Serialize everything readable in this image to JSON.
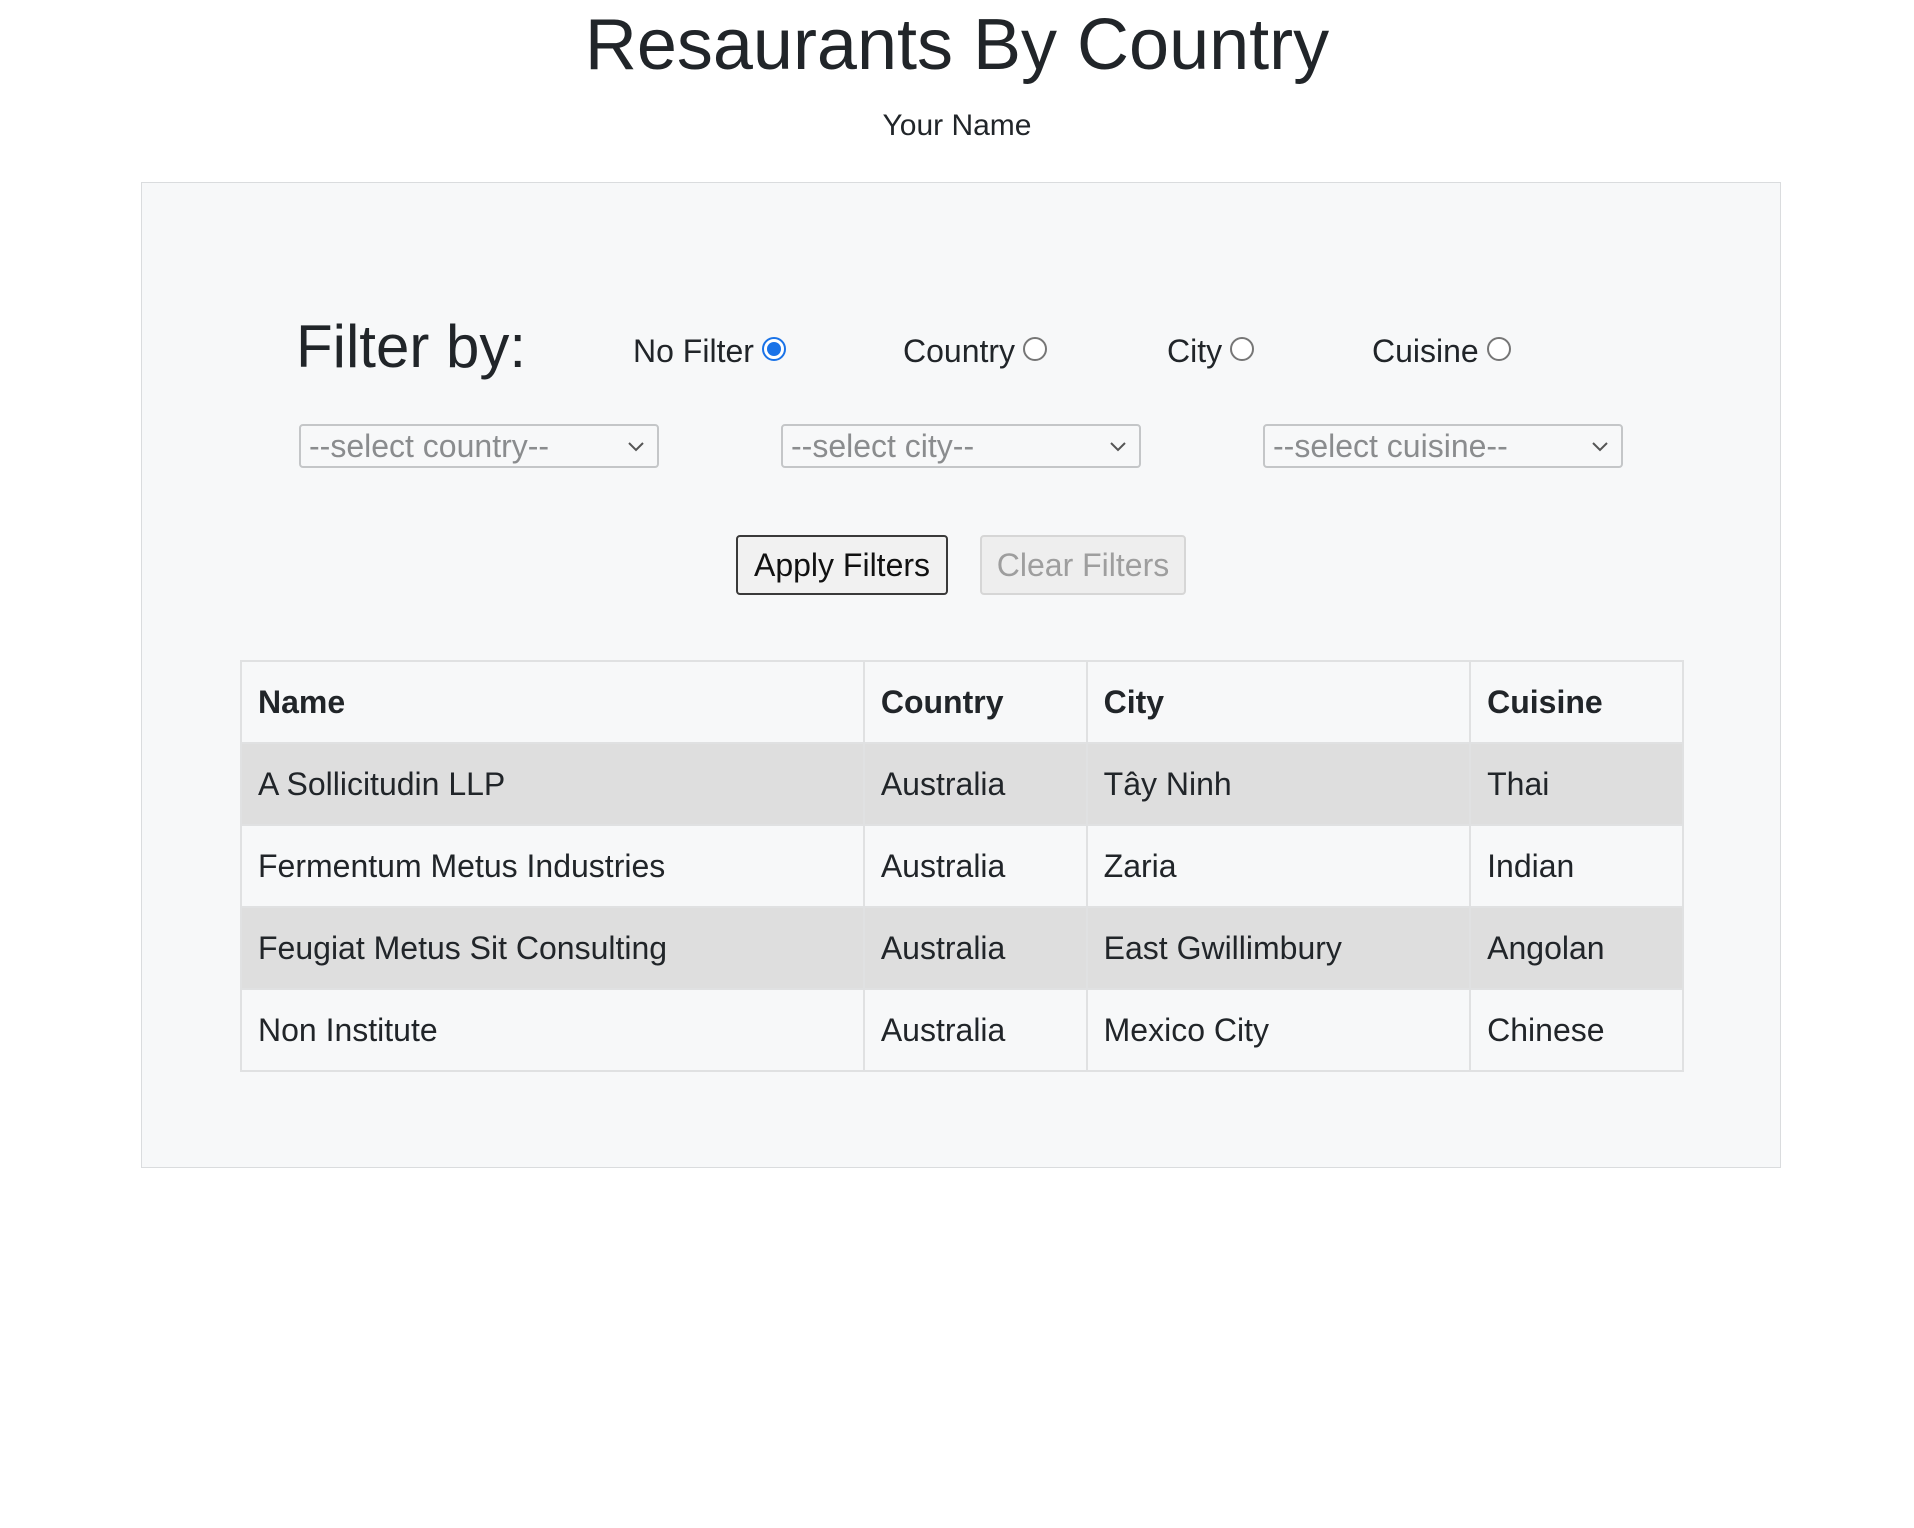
{
  "header": {
    "title": "Resaurants By Country",
    "subtitle": "Your Name"
  },
  "filters": {
    "heading": "Filter by:",
    "options": [
      {
        "label": "No Filter",
        "checked": true
      },
      {
        "label": "Country",
        "checked": false
      },
      {
        "label": "City",
        "checked": false
      },
      {
        "label": "Cuisine",
        "checked": false
      }
    ],
    "selects": {
      "country_placeholder": "--select country--",
      "city_placeholder": "--select city--",
      "cuisine_placeholder": "--select cuisine--"
    },
    "apply_label": "Apply Filters",
    "clear_label": "Clear Filters"
  },
  "table": {
    "headers": [
      "Name",
      "Country",
      "City",
      "Cuisine"
    ],
    "rows": [
      [
        "A Sollicitudin LLP",
        "Australia",
        "Tây Ninh",
        "Thai"
      ],
      [
        "Fermentum Metus Industries",
        "Australia",
        "Zaria",
        "Indian"
      ],
      [
        "Feugiat Metus Sit Consulting",
        "Australia",
        "East Gwillimbury",
        "Angolan"
      ],
      [
        "Non Institute",
        "Australia",
        "Mexico City",
        "Chinese"
      ]
    ]
  },
  "colors": {
    "radio_accent": "#1a73e8",
    "panel_background": "#f7f8f9",
    "striped_row": "#dedede"
  }
}
